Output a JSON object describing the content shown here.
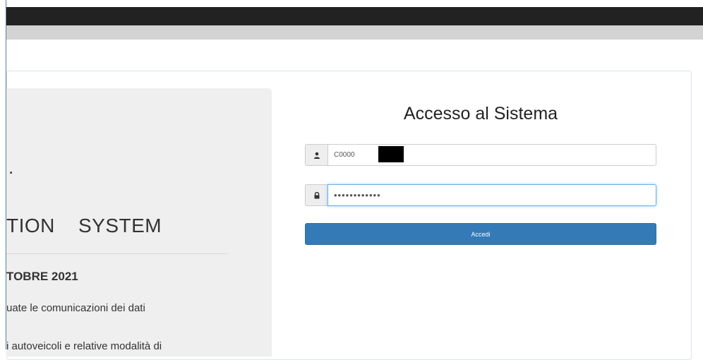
{
  "left_panel": {
    "heading_fragment": ".",
    "system_title": "TION    SYSTEM",
    "date_heading": "TOBRE 2021",
    "text_line_1": "uate le comunicazioni dei dati",
    "text_line_2": "i autoveicoli e relative modalità di"
  },
  "login": {
    "title": "Accesso al Sistema",
    "username_value": "C0000",
    "password_value": "••••••••••••",
    "submit_label": "Accedi",
    "user_icon": "user-icon",
    "lock_icon": "lock-icon"
  },
  "colors": {
    "topbar": "#222222",
    "button": "#337ab7"
  }
}
